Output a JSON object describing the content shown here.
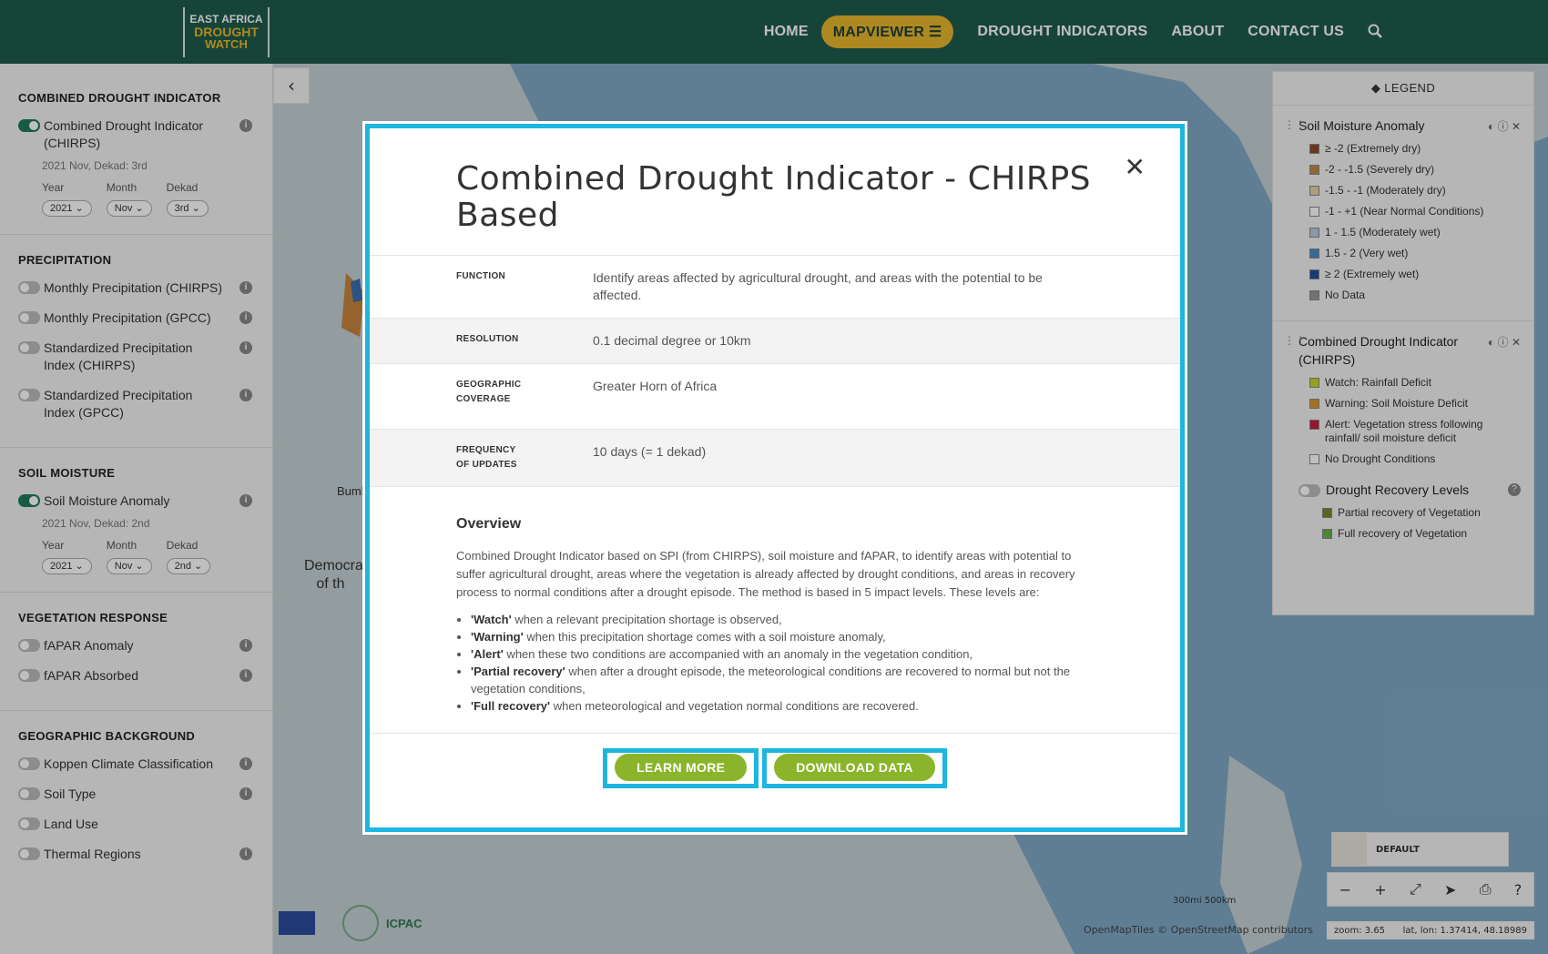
{
  "header": {
    "logo": {
      "line1": "EAST AFRICA",
      "line2": "DROUGHT",
      "line3": "WATCH"
    },
    "nav": [
      "HOME",
      "MAPVIEWER",
      "DROUGHT INDICATORS",
      "ABOUT",
      "CONTACT US"
    ],
    "active_nav": "MAPVIEWER"
  },
  "sidebar": {
    "combined": {
      "heading": "COMBINED DROUGHT INDICATOR",
      "layer": "Combined Drought Indicator (CHIRPS)",
      "date": "2021 Nov, Dekad: 3rd",
      "year_label": "Year",
      "month_label": "Month",
      "dekad_label": "Dekad",
      "year": "2021",
      "month": "Nov",
      "dekad": "3rd"
    },
    "precipitation": {
      "heading": "PRECIPITATION",
      "items": [
        "Monthly Precipitation (CHIRPS)",
        "Monthly Precipitation (GPCC)",
        "Standardized Precipitation Index (CHIRPS)",
        "Standardized Precipitation Index (GPCC)"
      ]
    },
    "soil": {
      "heading": "SOIL MOISTURE",
      "layer": "Soil Moisture Anomaly",
      "date": "2021 Nov, Dekad: 2nd",
      "year_label": "Year",
      "month_label": "Month",
      "dekad_label": "Dekad",
      "year": "2021",
      "month": "Nov",
      "dekad": "2nd"
    },
    "vegetation": {
      "heading": "VEGETATION RESPONSE",
      "items": [
        "fAPAR Anomaly",
        "fAPAR Absorbed"
      ]
    },
    "geo": {
      "heading": "GEOGRAPHIC BACKGROUND",
      "items": [
        "Koppen Climate Classification",
        "Soil Type",
        "Land Use",
        "Thermal Regions"
      ]
    }
  },
  "legend": {
    "title": "LEGEND",
    "soil": {
      "title": "Soil Moisture Anomaly",
      "items": [
        {
          "label": "≥ -2 (Extremely dry)",
          "color": "#8b4a2b"
        },
        {
          "label": "-2 - -1.5 (Severely dry)",
          "color": "#c08a4a"
        },
        {
          "label": "-1.5 - -1 (Moderately dry)",
          "color": "#e3d2a8"
        },
        {
          "label": "-1 - +1 (Near Normal Conditions)",
          "color": "#ffffff"
        },
        {
          "label": "1 - 1.5 (Moderately wet)",
          "color": "#b6cde0"
        },
        {
          "label": "1.5 - 2 (Very wet)",
          "color": "#4a8cc8"
        },
        {
          "label": "≥ 2 (Extremely wet)",
          "color": "#1f4f9e"
        },
        {
          "label": "No Data",
          "color": "#999999"
        }
      ]
    },
    "cdi": {
      "title": "Combined Drought Indicator (CHIRPS)",
      "items": [
        {
          "label": "Watch: Rainfall Deficit",
          "color": "#c9d62a"
        },
        {
          "label": "Warning: Soil Moisture Deficit",
          "color": "#d99a2b"
        },
        {
          "label": "Alert: Vegetation stress following rainfall/ soil moisture deficit",
          "color": "#c41e3a"
        },
        {
          "label": "No Drought Conditions",
          "color": "#ffffff"
        }
      ],
      "recovery_title": "Drought Recovery Levels",
      "recovery": [
        {
          "label": "Partial recovery of Vegetation",
          "color": "#7a8a2a"
        },
        {
          "label": "Full recovery of Vegetation",
          "color": "#6bb04a"
        }
      ]
    }
  },
  "map": {
    "label_a": "Bumb",
    "label_b": "Democra\nof th",
    "basemap": "DEFAULT",
    "zoom": "zoom: 3.65",
    "latlon": "lat, lon: 1.37414, 48.18989",
    "attribution": "OpenMapTiles  © OpenStreetMap contributors",
    "scale": "300mi    500km",
    "logo_text": "ICPAC"
  },
  "modal": {
    "title": "Combined Drought Indicator - CHIRPS Based",
    "rows": [
      {
        "key": "FUNCTION",
        "value": "Identify areas affected by agricultural drought, and areas with the potential to be affected."
      },
      {
        "key": "RESOLUTION",
        "value": "0.1 decimal degree or 10km"
      },
      {
        "key": "GEOGRAPHIC COVERAGE",
        "value": "Greater Horn of Africa"
      },
      {
        "key": "FREQUENCY OF UPDATES",
        "value": "10 days (= 1 dekad)"
      }
    ],
    "overview_title": "Overview",
    "overview_text": "Combined Drought Indicator based on SPI (from CHIRPS), soil moisture and fAPAR, to identify areas with potential to suffer agricultural drought, areas where the vegetation is already affected by drought conditions, and areas in recovery process to normal conditions after a drought episode. The method is based in 5 impact levels. These levels are:",
    "levels": [
      {
        "term": "'Watch'",
        "text": " when a relevant precipitation shortage is observed,"
      },
      {
        "term": "'Warning'",
        "text": " when this precipitation shortage comes with a soil moisture anomaly,"
      },
      {
        "term": "'Alert'",
        "text": " when these two conditions are accompanied with an anomaly in the vegetation condition,"
      },
      {
        "term": "'Partial recovery'",
        "text": " when after a drought episode, the meteorological conditions are recovered to normal but not the vegetation conditions,"
      },
      {
        "term": "'Full recovery'",
        "text": " when meteorological and vegetation normal conditions are recovered."
      }
    ],
    "learn_more": "LEARN MORE",
    "download": "DOWNLOAD DATA"
  }
}
